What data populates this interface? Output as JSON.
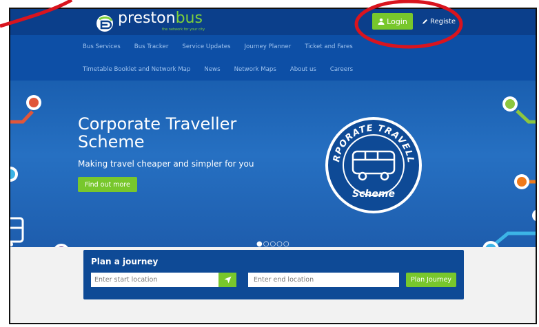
{
  "header": {
    "logo_brand_1": "preston",
    "logo_brand_2": "bus",
    "logo_tagline": "the network for your city",
    "login_label": "Login",
    "register_label": "Registe"
  },
  "nav": {
    "row1": [
      "Bus Services",
      "Bus Tracker",
      "Service Updates",
      "Journey Planner",
      "Ticket and Fares"
    ],
    "row2": [
      "Timetable Booklet and Network Map",
      "News",
      "Network Maps",
      "About us",
      "Careers"
    ]
  },
  "hero": {
    "title": "Corporate Traveller Scheme",
    "subtitle": "Making travel cheaper and simpler for you",
    "cta_label": "Find out more",
    "badge_top": "CORPORATE TRAVELLER",
    "badge_bottom": "Scheme",
    "carousel_dots": "●○○○○"
  },
  "planner": {
    "title": "Plan a journey",
    "start_placeholder": "Enter start location",
    "end_placeholder": "Enter end location",
    "submit_label": "Plan Journey"
  },
  "colors": {
    "topbar": "#0b3f8b",
    "nav": "#0d4fa6",
    "accent_green": "#78c72c",
    "annotation_red": "#d9141e"
  }
}
